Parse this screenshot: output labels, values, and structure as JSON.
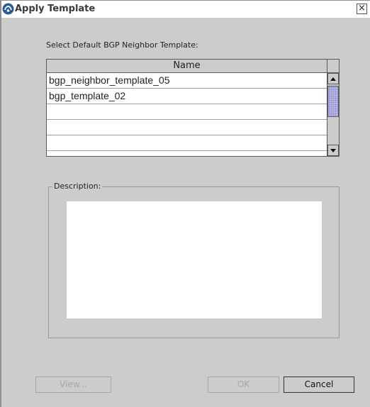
{
  "window": {
    "title": "Apply Template",
    "close_glyph": "×",
    "icon": "sun-logo-icon"
  },
  "prompt": "Select Default BGP Neighbor Template:",
  "table": {
    "header": "Name",
    "rows": [
      "bgp_neighbor_template_05",
      "bgp_template_02",
      "",
      "",
      ""
    ]
  },
  "description": {
    "label": "Description:",
    "value": ""
  },
  "buttons": {
    "view": "View...",
    "ok": "OK",
    "cancel": "Cancel"
  },
  "colors": {
    "dialog_bg": "#cccccc",
    "scroll_thumb": "#b7b7e6",
    "disabled_text": "#a8a8a8"
  }
}
